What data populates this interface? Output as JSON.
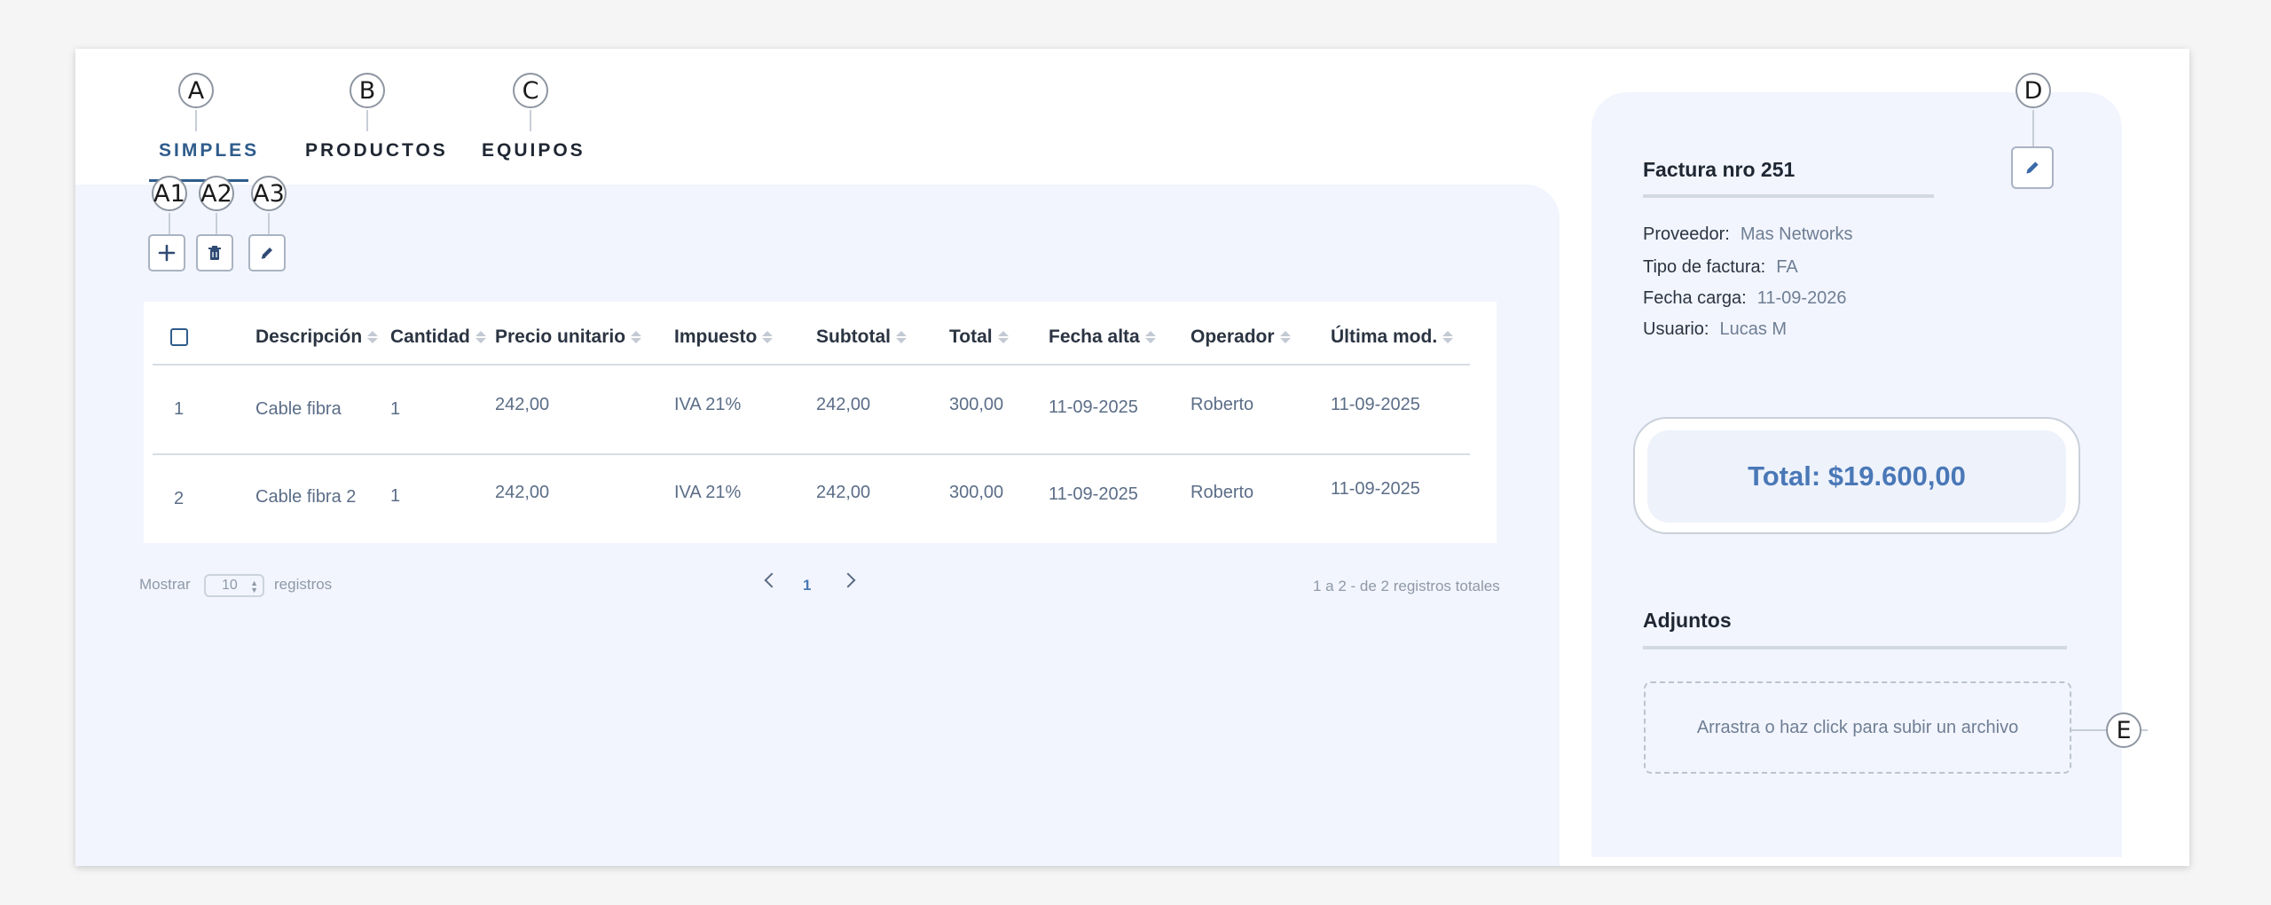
{
  "tabs": [
    {
      "label": "SIMPLES",
      "marker": "A",
      "active": true
    },
    {
      "label": "PRODUCTOS",
      "marker": "B",
      "active": false
    },
    {
      "label": "EQUIPOS",
      "marker": "C",
      "active": false
    }
  ],
  "toolbar": {
    "markers": [
      "A1",
      "A2",
      "A3"
    ],
    "buttons": [
      "add-icon",
      "trash-icon",
      "pencil-icon"
    ]
  },
  "table": {
    "headers": [
      "Descripción",
      "Cantidad",
      "Precio unitario",
      "Impuesto",
      "Subtotal",
      "Total",
      "Fecha alta",
      "Operador",
      "Última mod."
    ],
    "rows": [
      [
        "1",
        "Cable fibra",
        "1",
        "242,00",
        "IVA 21%",
        "242,00",
        "300,00",
        "11-09-2025",
        "Roberto",
        "11-09-2025"
      ],
      [
        "2",
        "Cable fibra 2",
        "1",
        "242,00",
        "IVA 21%",
        "242,00",
        "300,00",
        "11-09-2025",
        "Roberto",
        "11-09-2025"
      ]
    ]
  },
  "pagination": {
    "show_label": "Mostrar",
    "page_size": "10",
    "records_label": "registros",
    "current_page": "1",
    "summary": "1 a 2 - de 2 registros totales"
  },
  "invoice": {
    "title": "Factura nro 251",
    "edit_marker": "D",
    "fields": [
      {
        "label": "Proveedor:",
        "value": "Mas Networks"
      },
      {
        "label": "Tipo de factura:",
        "value": "FA"
      },
      {
        "label": "Fecha carga:",
        "value": "11-09-2026"
      },
      {
        "label": "Usuario:",
        "value": "Lucas M"
      }
    ],
    "total": "Total:  $19.600,00",
    "attachments_title": "Adjuntos",
    "dropzone_text": "Arrastra o haz click para subir un archivo",
    "dropzone_marker": "E"
  },
  "colors": {
    "accent": "#2f5c8c",
    "panel": "#f2f5fd",
    "total_text": "#4a78b7"
  }
}
